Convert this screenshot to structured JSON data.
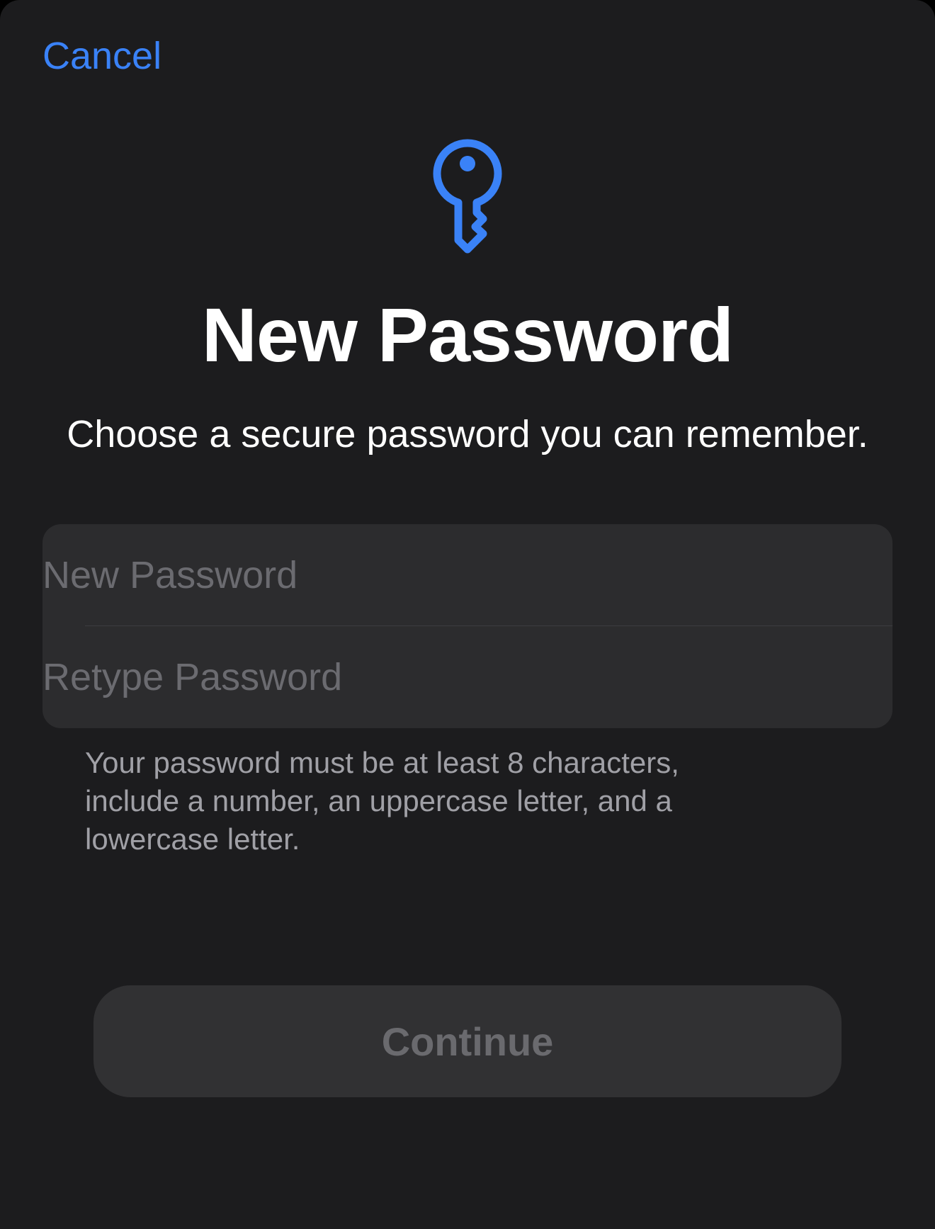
{
  "header": {
    "cancel_label": "Cancel"
  },
  "hero": {
    "icon": "key-icon",
    "title": "New Password",
    "subtitle": "Choose a secure password you can remember."
  },
  "form": {
    "new_password": {
      "value": "",
      "placeholder": "New Password"
    },
    "retype_password": {
      "value": "",
      "placeholder": "Retype Password"
    },
    "hint": "Your password must be at least 8 characters, include a number, an uppercase letter, and a lowercase letter."
  },
  "actions": {
    "continue_label": "Continue",
    "continue_enabled": false
  },
  "colors": {
    "background": "#1c1c1e",
    "accent": "#3a82f7",
    "field_background": "#2c2c2e",
    "placeholder": "#6b6b70",
    "hint_text": "#a0a0a6",
    "button_disabled_background": "#313133",
    "button_disabled_text": "#6a6a6e"
  }
}
